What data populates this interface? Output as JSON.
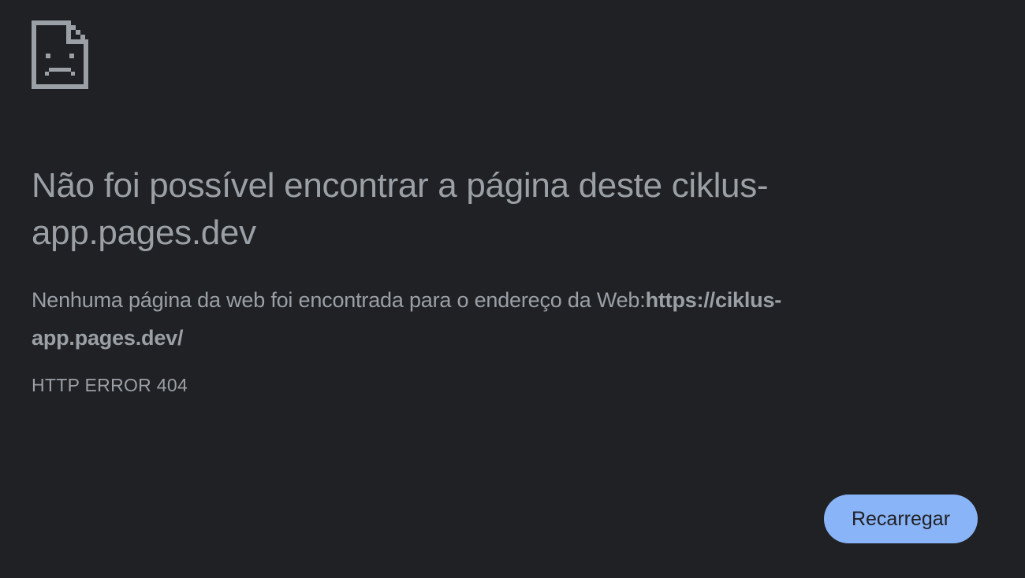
{
  "error_page": {
    "icon": "sad-document-icon",
    "heading": "Não foi possível encontrar a página deste ciklus-app.pages.dev",
    "description_prefix": "Nenhuma página da web foi encontrada para o endereço da Web:",
    "description_url": "https://ciklus-app.pages.dev/",
    "error_code": "HTTP ERROR 404",
    "reload_label": "Recarregar"
  },
  "colors": {
    "background": "#202124",
    "text": "#9aa0a6",
    "button_background": "#8ab4f8",
    "button_text": "#202124"
  }
}
